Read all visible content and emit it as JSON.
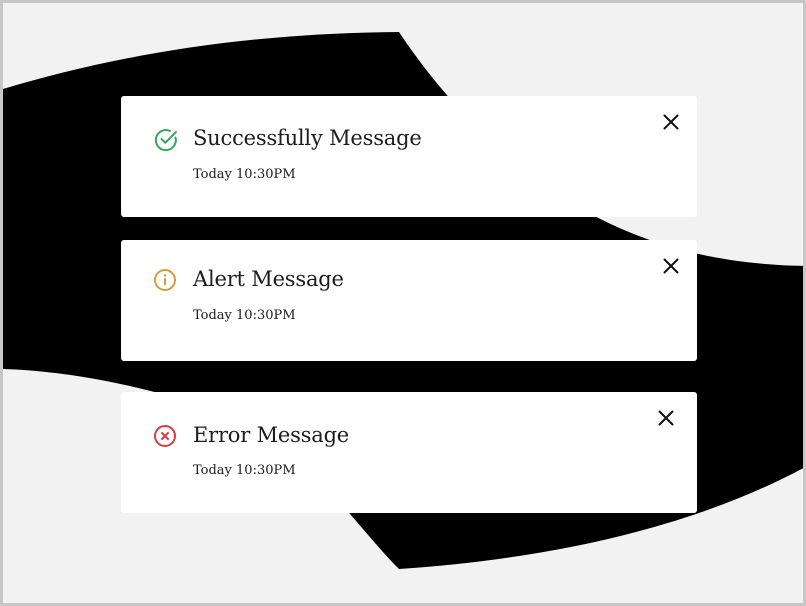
{
  "colors": {
    "background": "#f2f2f2",
    "blob": "#000000",
    "card": "#ffffff",
    "success": "#3aa55d",
    "alert": "#d39a3f",
    "error": "#e0393e",
    "text": "#1c1c1c"
  },
  "notifications": [
    {
      "type": "success",
      "icon": "check-circle-icon",
      "title": "Successfully Message",
      "time": "Today 10:30PM",
      "close_icon": "close-icon"
    },
    {
      "type": "alert",
      "icon": "info-circle-icon",
      "title": "Alert Message",
      "time": "Today 10:30PM",
      "close_icon": "close-icon"
    },
    {
      "type": "error",
      "icon": "x-circle-icon",
      "title": "Error Message",
      "time": "Today 10:30PM",
      "close_icon": "close-icon"
    }
  ]
}
